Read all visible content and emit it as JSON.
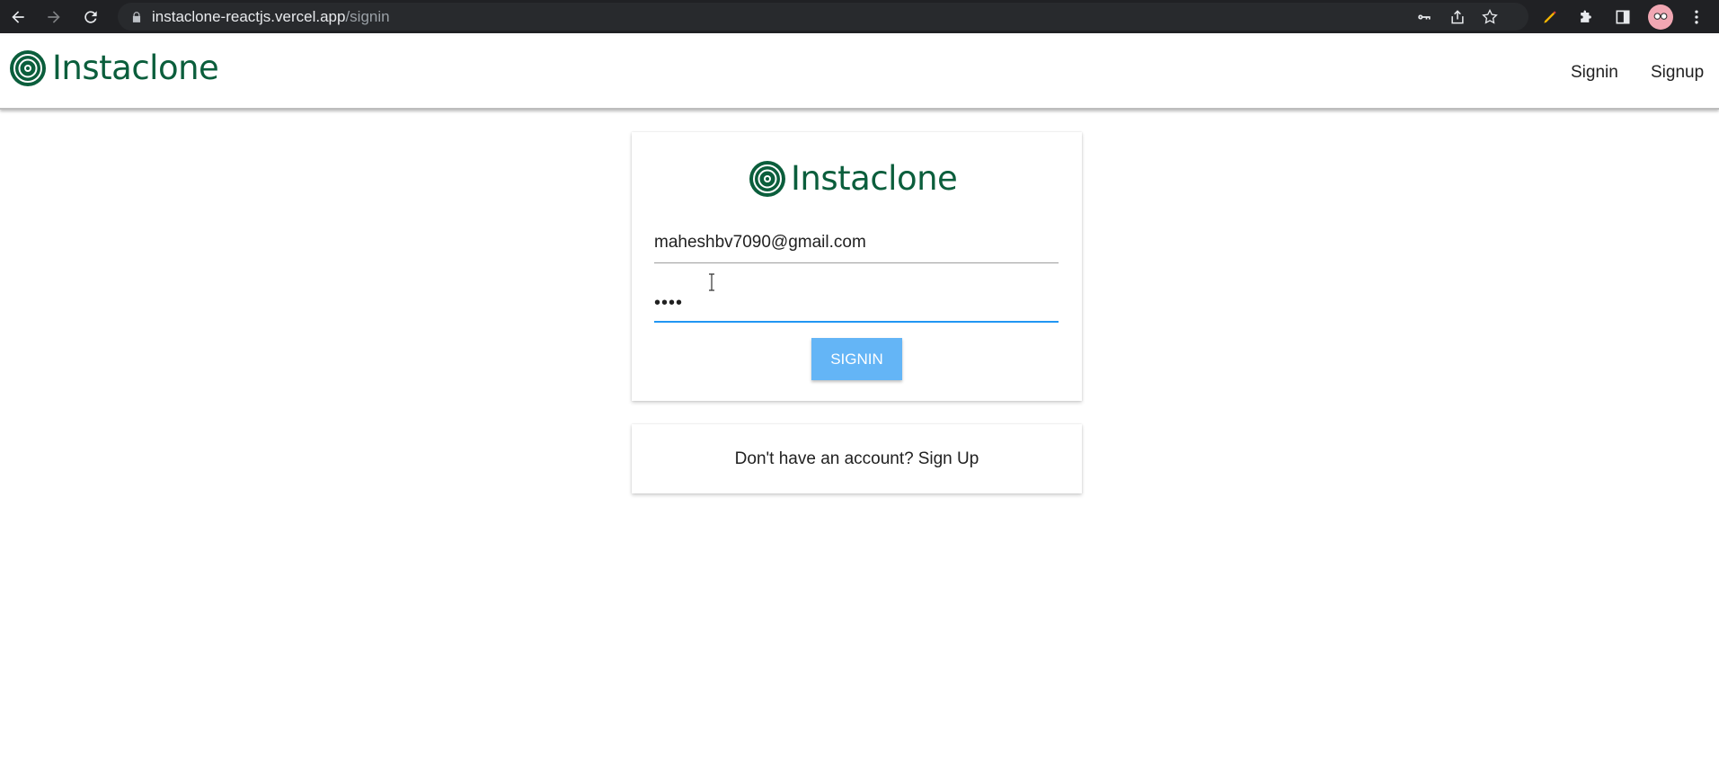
{
  "browser": {
    "url_host": "instaclone-reactjs.vercel.app",
    "url_path": "/signin",
    "icons": [
      "back-arrow-icon",
      "forward-arrow-icon",
      "reload-icon",
      "lock-icon",
      "key-icon",
      "share-icon",
      "star-icon",
      "pen-icon",
      "puzzle-icon",
      "sidepanel-icon",
      "avatar",
      "kebab-menu-icon"
    ]
  },
  "header": {
    "brand": "Instaclone",
    "nav": {
      "signin": "Signin",
      "signup": "Signup"
    }
  },
  "signin_card": {
    "brand": "Instaclone",
    "email_value": "maheshbv7090@gmail.com",
    "password_dots": "••••",
    "button_label": "SIGNIN"
  },
  "signup_card": {
    "question": "Don't have an account?",
    "link": "Sign Up"
  },
  "colors": {
    "brand_green": "#0b5e3c",
    "button_blue": "#64b5f6",
    "focus_blue": "#2196f3"
  }
}
